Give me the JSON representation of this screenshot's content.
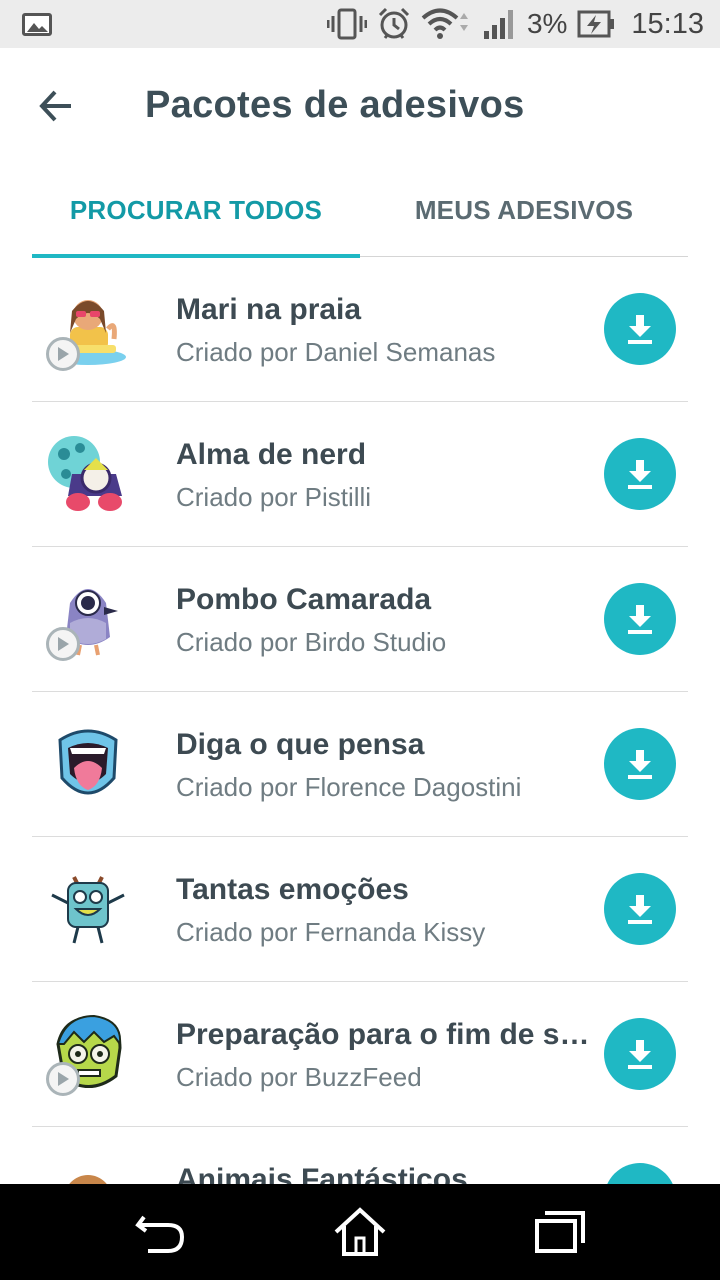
{
  "status_bar": {
    "battery_percent": "3%",
    "time": "15:13",
    "icons": [
      "gallery-icon",
      "vibrate-icon",
      "alarm-icon",
      "wifi-icon",
      "signal-icon",
      "battery-charging-icon"
    ]
  },
  "app_bar": {
    "back_icon": "arrow-back-icon",
    "title": "Pacotes de adesivos"
  },
  "tabs": [
    {
      "label": "PROCURAR TODOS",
      "active": true
    },
    {
      "label": "MEUS ADESIVOS",
      "active": false
    }
  ],
  "packs": [
    {
      "title": "Mari na praia",
      "author": "Criado por Daniel Semanas",
      "animated": true,
      "icon": "beach-girl-sticker-icon"
    },
    {
      "title": "Alma de nerd",
      "author": "Criado por Pistilli",
      "animated": false,
      "icon": "nerd-sticker-icon"
    },
    {
      "title": "Pombo Camarada",
      "author": "Criado por Birdo Studio",
      "animated": true,
      "icon": "pigeon-sticker-icon"
    },
    {
      "title": "Diga o que pensa",
      "author": "Criado por Florence Dagostini",
      "animated": false,
      "icon": "mouth-sticker-icon"
    },
    {
      "title": "Tantas emoções",
      "author": "Criado por Fernanda Kissy",
      "animated": false,
      "icon": "monster-sticker-icon"
    },
    {
      "title": "Preparação para o fim de s…",
      "author": "Criado por BuzzFeed",
      "animated": true,
      "icon": "zombie-sticker-icon"
    },
    {
      "title": "Animais Fantásticos",
      "author": "",
      "animated": false,
      "icon": "fantastic-animals-sticker-icon"
    }
  ],
  "colors": {
    "accent": "#1fb8c4",
    "accent_text": "#139aa6",
    "title_text": "#3d4f58",
    "secondary_text": "#6f7c82"
  },
  "nav_bar": {
    "icons": [
      "nav-back-icon",
      "nav-home-icon",
      "nav-recents-icon"
    ]
  }
}
